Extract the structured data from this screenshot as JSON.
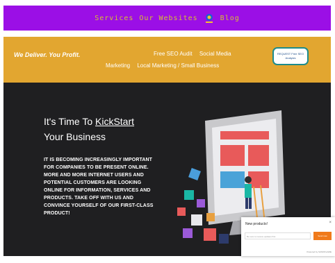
{
  "nav": {
    "items": [
      "Services",
      "Our Websites",
      "Blog"
    ]
  },
  "header": {
    "tagline": "We Deliver. You Profit.",
    "menu_line1": [
      "Free SEO Audit",
      "Social Media"
    ],
    "menu_line2": [
      "Marketing",
      "Local Marketing / Small Business"
    ],
    "cta_label": "REQUEST Free SEO Analysis"
  },
  "hero": {
    "title_prefix": "It's Time To ",
    "title_link": "KickStart",
    "title_suffix": "Your Business",
    "body": "It is becoming increasingly important for companies to be present online. More and more internet users and potential customers are looking online for information, services and products. Take off with us and convince yourself of our first-class product!"
  },
  "popup": {
    "title": "New products!",
    "close": "×",
    "input_placeholder": "Be sure to receive updates first",
    "button_label": "Send now",
    "footer": "Powered by SUMOFLAME"
  },
  "colors": {
    "purple": "#9b0fe6",
    "gold": "#e2a630",
    "dark": "#1f1f21",
    "orange": "#f07a1a"
  }
}
